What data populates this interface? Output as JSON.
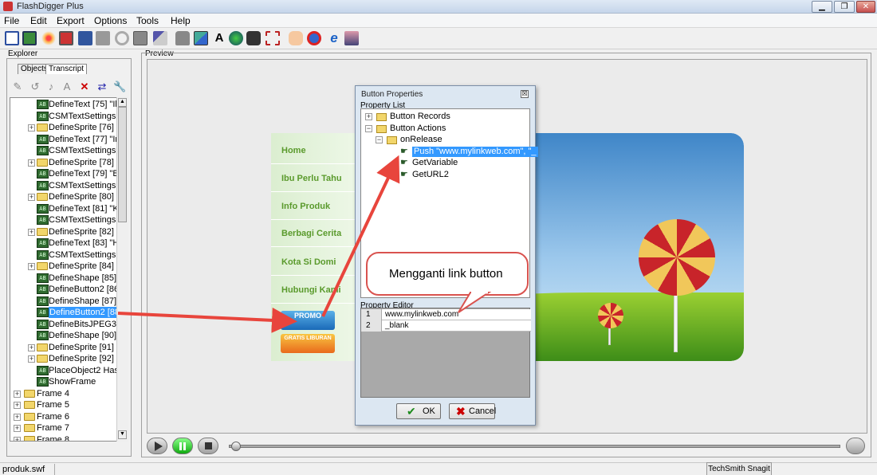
{
  "window": {
    "title": "FlashDigger Plus",
    "controls": [
      "▁",
      "❐",
      "✕"
    ]
  },
  "menu": [
    "File",
    "Edit",
    "Export",
    "Options",
    "Tools",
    "Help"
  ],
  "toolbar": [
    "new-icon",
    "open-icon",
    "burst-icon",
    "import-icon",
    "save-icon",
    "save-as-icon",
    "link-icon",
    "image-icon",
    "brush-icon",
    "lock-icon",
    "picture-icon",
    "font-icon",
    "globe-icon",
    "network-icon",
    "crop-icon",
    "hand-icon",
    "stop-icon",
    "ie-icon",
    "user-icon"
  ],
  "explorer": {
    "label": "Explorer",
    "tabs": [
      "Objects",
      "Transcript"
    ],
    "tree": [
      {
        "text": "DefineText [75] \"Il",
        "icon": "tag",
        "indent": 1
      },
      {
        "text": "CSMTextSettings [",
        "icon": "tag",
        "indent": 1
      },
      {
        "text": "DefineSprite [76]",
        "icon": "folder",
        "indent": 1,
        "expander": true
      },
      {
        "text": "DefineText [77] \"In",
        "icon": "tag",
        "indent": 1
      },
      {
        "text": "CSMTextSettings [",
        "icon": "tag",
        "indent": 1
      },
      {
        "text": "DefineSprite [78]",
        "icon": "folder",
        "indent": 1,
        "expander": true
      },
      {
        "text": "DefineText [79] \"B",
        "icon": "tag",
        "indent": 1
      },
      {
        "text": "CSMTextSettings [",
        "icon": "tag",
        "indent": 1
      },
      {
        "text": "DefineSprite [80]",
        "icon": "folder",
        "indent": 1,
        "expander": true
      },
      {
        "text": "DefineText [81] \"K",
        "icon": "tag",
        "indent": 1
      },
      {
        "text": "CSMTextSettings [",
        "icon": "tag",
        "indent": 1
      },
      {
        "text": "DefineSprite [82]",
        "icon": "folder",
        "indent": 1,
        "expander": true
      },
      {
        "text": "DefineText [83] \"H",
        "icon": "tag",
        "indent": 1
      },
      {
        "text": "CSMTextSettings [",
        "icon": "tag",
        "indent": 1
      },
      {
        "text": "DefineSprite [84]",
        "icon": "folder",
        "indent": 1,
        "expander": true
      },
      {
        "text": "DefineShape [85]",
        "icon": "tag",
        "indent": 1
      },
      {
        "text": "DefineButton2 [86]",
        "icon": "tag",
        "indent": 1
      },
      {
        "text": "DefineShape [87]",
        "icon": "tag",
        "indent": 1
      },
      {
        "text": "DefineButton2 [88",
        "icon": "tag",
        "indent": 1,
        "selected": true
      },
      {
        "text": "DefineBitsJPEG3 [8",
        "icon": "tag",
        "indent": 1
      },
      {
        "text": "DefineShape [90]",
        "icon": "tag",
        "indent": 1
      },
      {
        "text": "DefineSprite [91]",
        "icon": "folder",
        "indent": 1,
        "expander": true
      },
      {
        "text": "DefineSprite [92]",
        "icon": "folder",
        "indent": 1,
        "expander": true
      },
      {
        "text": "PlaceObject2 HasC",
        "icon": "tag",
        "indent": 1
      },
      {
        "text": "ShowFrame",
        "icon": "tag",
        "indent": 1
      },
      {
        "text": "Frame 4",
        "icon": "folder",
        "indent": 0,
        "expander": true
      },
      {
        "text": "Frame 5",
        "icon": "folder",
        "indent": 0,
        "expander": true
      },
      {
        "text": "Frame 6",
        "icon": "folder",
        "indent": 0,
        "expander": true
      },
      {
        "text": "Frame 7",
        "icon": "folder",
        "indent": 0,
        "expander": true
      },
      {
        "text": "Frame 8",
        "icon": "folder",
        "indent": 0,
        "expander": true
      }
    ]
  },
  "preview": {
    "label": "Preview",
    "menu_items": [
      "Home",
      "Ibu Perlu Tahu",
      "Info Produk",
      "Berbagi Cerita",
      "Kota Si Domi",
      "Hubungi Kami"
    ],
    "promo1": "PROMO",
    "promo2": "GRATIS LIBURAN"
  },
  "dialog": {
    "title": "Button Properties",
    "close": "☒",
    "property_list_label": "Property List",
    "property_list": [
      {
        "text": "Button Records",
        "icon": "folder",
        "indent": 0,
        "expander": "+"
      },
      {
        "text": "Button Actions",
        "icon": "folder-open",
        "indent": 0,
        "expander": "−"
      },
      {
        "text": "onRelease",
        "icon": "folder-open",
        "indent": 1,
        "expander": "−"
      },
      {
        "text": "Push \"www.mylinkweb.com\", \"_",
        "icon": "hand",
        "indent": 2,
        "selected": true
      },
      {
        "text": "GetVariable",
        "icon": "hand",
        "indent": 2
      },
      {
        "text": "GetURL2",
        "icon": "hand",
        "indent": 2
      }
    ],
    "property_editor_label": "Property Editor",
    "property_editor": [
      {
        "n": "1",
        "v": "www.mylinkweb.com"
      },
      {
        "n": "2",
        "v": "_blank"
      }
    ],
    "ok": "OK",
    "cancel": "Cancel"
  },
  "callout": "Mengganti link button",
  "status": {
    "file": "produk.swf",
    "snagit": "TechSmith Snagit"
  },
  "colors": {
    "accent": "#3399ff",
    "arrow": "#e8453c",
    "menu_green": "#5a9a2c"
  }
}
